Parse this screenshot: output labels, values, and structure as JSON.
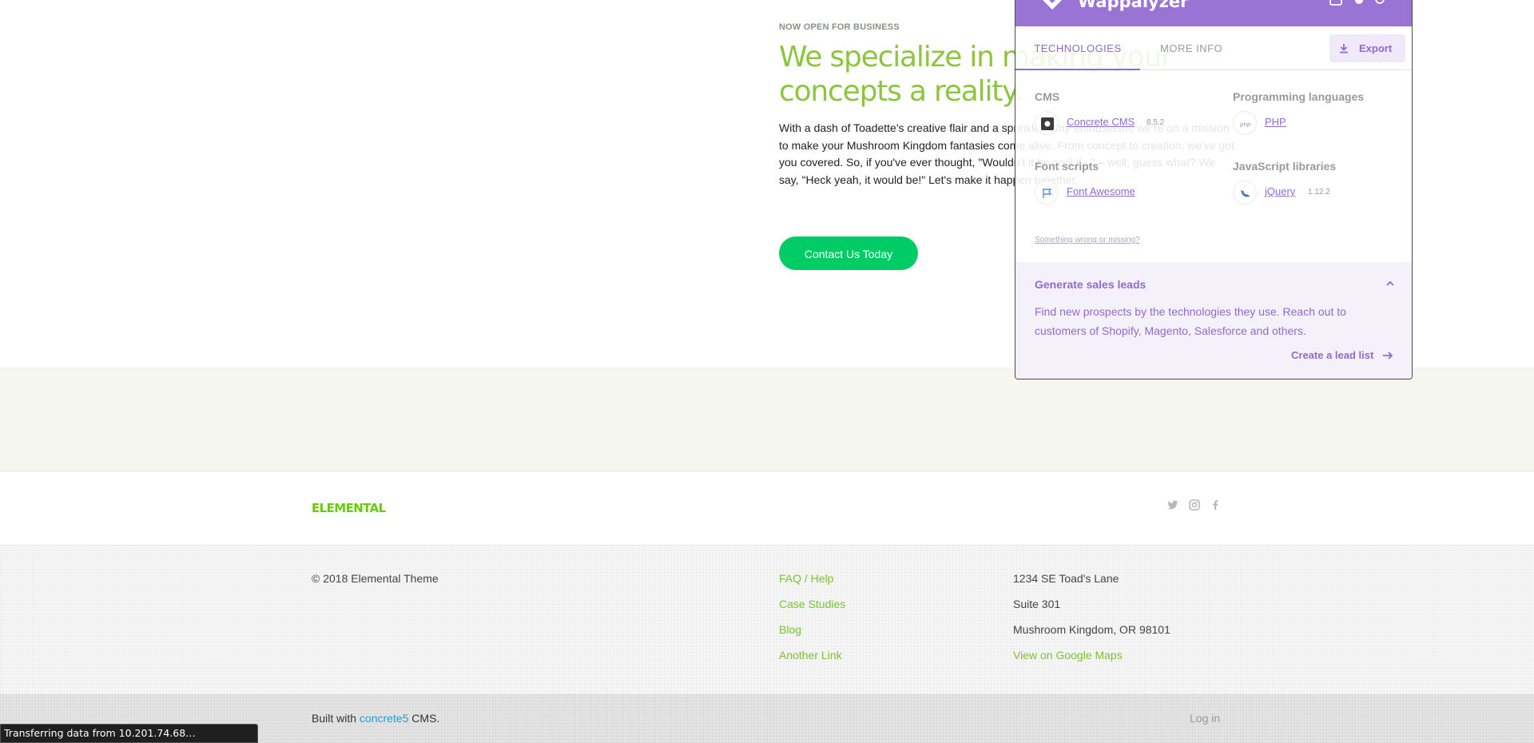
{
  "hero": {
    "eyebrow": "NOW OPEN FOR BUSINESS",
    "headline": "We specialize in making your concepts a reality.",
    "body": "With a dash of Toadette's creative flair and a sprinkle of my enthusiasm, we're on a mission to make your Mushroom Kingdom fantasies come alive. From concept to creation, we've got you covered. So, if you've ever thought, \"Wouldn't it be cool if...\" – well, guess what? We say, \"Heck yeah, it would be!\" Let's make it happen together.",
    "cta_label": "Contact Us Today"
  },
  "brand": {
    "logo_text": "ELEMENTAL",
    "social_icons": [
      "twitter-icon",
      "instagram-icon",
      "facebook-icon"
    ]
  },
  "footer": {
    "copyright": "© 2018 Elemental Theme",
    "links": [
      "FAQ / Help",
      "Case Studies",
      "Blog",
      "Another Link"
    ],
    "address": {
      "line1": "1234 SE Toad's Lane",
      "line2": "Suite 301",
      "line3": "Mushroom Kingdom, OR 98101",
      "maps_link": "View on Google Maps"
    }
  },
  "bottom_bar": {
    "built_prefix": "Built with",
    "built_link": "concrete5",
    "built_suffix": "CMS.",
    "login": "Log in"
  },
  "browser_status": "Transferring data from 10.201.74.68…",
  "wappalyzer": {
    "title": "Wappalyzer",
    "tabs": {
      "technologies": "TECHNOLOGIES",
      "more_info": "MORE INFO"
    },
    "export_label": "Export",
    "categories": {
      "cms": {
        "title": "CMS",
        "items": [
          {
            "name": "Concrete CMS",
            "version": "8.5.2",
            "icon": "concrete-cms-icon"
          }
        ]
      },
      "font_scripts": {
        "title": "Font scripts",
        "items": [
          {
            "name": "Font Awesome",
            "version": "",
            "icon": "flag-icon"
          }
        ]
      },
      "programming_languages": {
        "title": "Programming languages",
        "items": [
          {
            "name": "PHP",
            "version": "",
            "icon": "php-icon"
          }
        ]
      },
      "javascript_libraries": {
        "title": "JavaScript libraries",
        "items": [
          {
            "name": "jQuery",
            "version": "1.12.2",
            "icon": "jquery-icon"
          }
        ]
      }
    },
    "feedback_link": "Something wrong or missing?",
    "leads": {
      "title": "Generate sales leads",
      "text": "Find new prospects by the technologies they use. Reach out to customers of Shopify, Magento, Salesforce and others.",
      "cta": "Create a lead list"
    }
  },
  "colors": {
    "brand_green": "#8cc63f",
    "cta_green": "#00cc66",
    "link_green": "#7ac231",
    "wappalyzer_purple": "#8e6bd0",
    "concrete_blue": "#1e9fd9"
  }
}
